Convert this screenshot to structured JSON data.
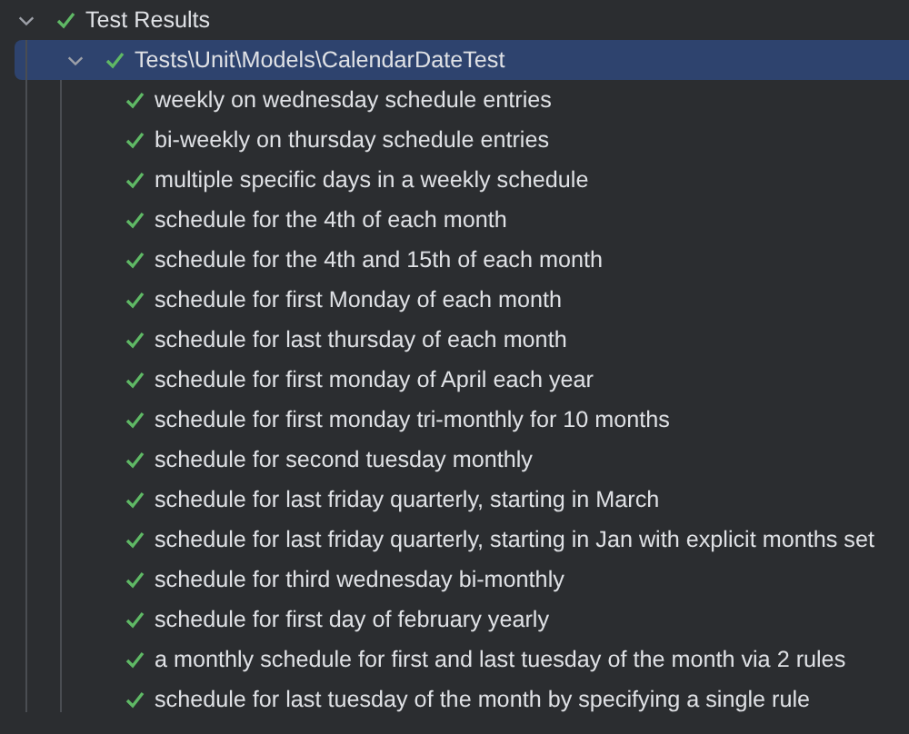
{
  "tree": [
    {
      "label": "Test Results",
      "passed": true,
      "expanded": true,
      "selected": false,
      "children": [
        {
          "label": "Tests\\Unit\\Models\\CalendarDateTest",
          "passed": true,
          "expanded": true,
          "selected": true,
          "children": [
            {
              "label": "weekly on wednesday schedule entries",
              "passed": true,
              "selected": false
            },
            {
              "label": "bi-weekly on thursday schedule entries",
              "passed": true,
              "selected": false
            },
            {
              "label": "multiple specific days in a weekly schedule",
              "passed": true,
              "selected": false
            },
            {
              "label": "schedule for the 4th of each month",
              "passed": true,
              "selected": false
            },
            {
              "label": "schedule for the 4th and 15th of each month",
              "passed": true,
              "selected": false
            },
            {
              "label": "schedule for first Monday of each month",
              "passed": true,
              "selected": false
            },
            {
              "label": "schedule for last thursday of each month",
              "passed": true,
              "selected": false
            },
            {
              "label": "schedule for first monday of April each year",
              "passed": true,
              "selected": false
            },
            {
              "label": "schedule for first monday tri-monthly for 10 months",
              "passed": true,
              "selected": false
            },
            {
              "label": "schedule for second tuesday monthly",
              "passed": true,
              "selected": false
            },
            {
              "label": "schedule for last friday quarterly, starting in March",
              "passed": true,
              "selected": false
            },
            {
              "label": "schedule for last friday quarterly, starting in Jan with explicit months set",
              "passed": true,
              "selected": false
            },
            {
              "label": "schedule for third wednesday bi-monthly",
              "passed": true,
              "selected": false
            },
            {
              "label": "schedule for first day of february yearly",
              "passed": true,
              "selected": false
            },
            {
              "label": "a monthly schedule for first and last tuesday of the month via 2 rules",
              "passed": true,
              "selected": false
            },
            {
              "label": "schedule for last tuesday of the month by specifying a single rule",
              "passed": true,
              "selected": false
            }
          ]
        }
      ]
    }
  ]
}
